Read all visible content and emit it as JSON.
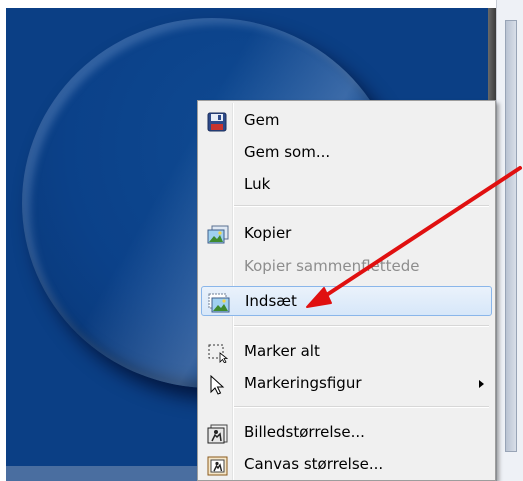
{
  "menu": {
    "items": [
      {
        "label": "Gem",
        "icon": "floppy-disk-icon",
        "enabled": true
      },
      {
        "label": "Gem som...",
        "icon": "",
        "enabled": true
      },
      {
        "label": "Luk",
        "icon": "",
        "enabled": true
      },
      {
        "label": "Kopier",
        "icon": "copy-image-icon",
        "enabled": true
      },
      {
        "label": "Kopier sammenflettede",
        "icon": "",
        "enabled": false
      },
      {
        "label": "Indsæt",
        "icon": "paste-image-icon",
        "enabled": true,
        "selected": true
      },
      {
        "label": "Marker alt",
        "icon": "select-all-icon",
        "enabled": true
      },
      {
        "label": "Markeringsfigur",
        "icon": "cursor-arrow-icon",
        "enabled": true,
        "has_submenu": true
      },
      {
        "label": "Billedstørrelse...",
        "icon": "image-size-icon",
        "enabled": true
      },
      {
        "label": "Canvas størrelse...",
        "icon": "canvas-size-icon",
        "enabled": true
      }
    ]
  },
  "colors": {
    "canvas": "#0b3f85",
    "annotation_arrow": "#e01010",
    "selection_border": "#8ab6ea"
  }
}
